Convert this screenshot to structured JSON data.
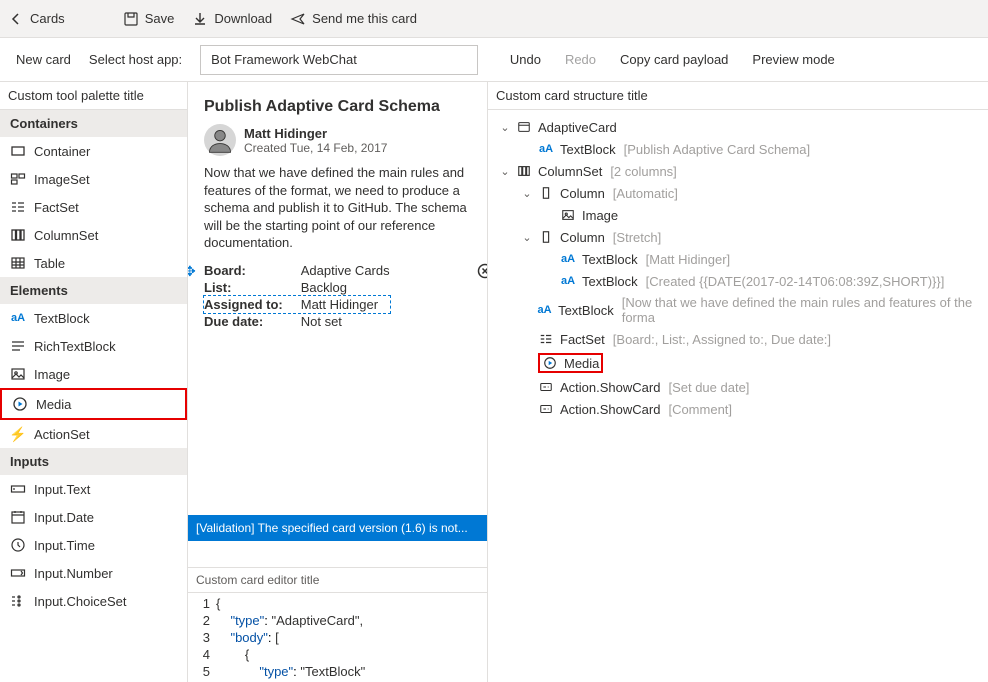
{
  "topbar": {
    "back": "Cards",
    "save": "Save",
    "download": "Download",
    "send": "Send me this card"
  },
  "secbar": {
    "newcard": "New card",
    "hostlabel": "Select host app:",
    "hostvalue": "Bot Framework WebChat",
    "undo": "Undo",
    "redo": "Redo",
    "copy": "Copy card payload",
    "preview": "Preview mode"
  },
  "leftpanel": {
    "title": "Custom tool palette title",
    "groups": [
      {
        "label": "Containers",
        "items": [
          {
            "label": "Container",
            "icon": "rect"
          },
          {
            "label": "ImageSet",
            "icon": "imgset"
          },
          {
            "label": "FactSet",
            "icon": "factset"
          },
          {
            "label": "ColumnSet",
            "icon": "cols"
          },
          {
            "label": "Table",
            "icon": "table"
          }
        ]
      },
      {
        "label": "Elements",
        "items": [
          {
            "label": "TextBlock",
            "icon": "aA"
          },
          {
            "label": "RichTextBlock",
            "icon": "rtb"
          },
          {
            "label": "Image",
            "icon": "img"
          },
          {
            "label": "Media",
            "icon": "media",
            "highlight": true
          },
          {
            "label": "ActionSet",
            "icon": "bolt"
          }
        ]
      },
      {
        "label": "Inputs",
        "items": [
          {
            "label": "Input.Text",
            "icon": "inputtext"
          },
          {
            "label": "Input.Date",
            "icon": "inputdate"
          },
          {
            "label": "Input.Time",
            "icon": "inputtime"
          },
          {
            "label": "Input.Number",
            "icon": "inputnum"
          },
          {
            "label": "Input.ChoiceSet",
            "icon": "inputchoice"
          }
        ]
      }
    ]
  },
  "card": {
    "title": "Publish Adaptive Card Schema",
    "author": "Matt Hidinger",
    "created": "Created Tue, 14 Feb, 2017",
    "body": "Now that we have defined the main rules and features of the format, we need to produce a schema and publish it to GitHub. The schema will be the starting point of our reference documentation.",
    "facts": [
      {
        "k": "Board:",
        "v": "Adaptive Cards"
      },
      {
        "k": "List:",
        "v": "Backlog"
      },
      {
        "k": "Assigned to:",
        "v": "Matt Hidinger",
        "selected": true
      },
      {
        "k": "Due date:",
        "v": "Not set"
      }
    ],
    "validation": "[Validation] The specified card version (1.6) is not..."
  },
  "structure": {
    "title": "Custom card structure title",
    "tree": [
      {
        "d": 0,
        "exp": true,
        "icon": "card",
        "label": "AdaptiveCard"
      },
      {
        "d": 1,
        "icon": "aA",
        "label": "TextBlock",
        "sub": "[Publish Adaptive Card Schema]"
      },
      {
        "d": 0,
        "exp": true,
        "icon": "cols",
        "label": "ColumnSet",
        "sub": "[2 columns]"
      },
      {
        "d": 1,
        "exp": true,
        "icon": "col",
        "label": "Column",
        "sub": "[Automatic]"
      },
      {
        "d": 2,
        "icon": "img",
        "label": "Image"
      },
      {
        "d": 1,
        "exp": true,
        "icon": "col",
        "label": "Column",
        "sub": "[Stretch]"
      },
      {
        "d": 2,
        "icon": "aA",
        "label": "TextBlock",
        "sub": "[Matt Hidinger]"
      },
      {
        "d": 2,
        "icon": "aA",
        "label": "TextBlock",
        "sub": "[Created {{DATE(2017-02-14T06:08:39Z,SHORT)}}]"
      },
      {
        "d": 1,
        "icon": "aA",
        "label": "TextBlock",
        "sub": "[Now that we have defined the main rules and features of the forma"
      },
      {
        "d": 1,
        "icon": "factset",
        "label": "FactSet",
        "sub": "[Board:, List:, Assigned to:, Due date:]"
      },
      {
        "d": 1,
        "icon": "media",
        "label": "Media",
        "highlight": true
      },
      {
        "d": 1,
        "icon": "action",
        "label": "Action.ShowCard",
        "sub": "[Set due date]"
      },
      {
        "d": 1,
        "icon": "action",
        "label": "Action.ShowCard",
        "sub": "[Comment]"
      }
    ]
  },
  "editor": {
    "title": "Custom card editor title",
    "lines": [
      {
        "n": 1,
        "raw": "{"
      },
      {
        "n": 2,
        "raw": "    \"type\": \"AdaptiveCard\","
      },
      {
        "n": 3,
        "raw": "    \"body\": ["
      },
      {
        "n": 4,
        "raw": "        {"
      },
      {
        "n": 5,
        "raw": "            \"type\": \"TextBlock\""
      }
    ]
  }
}
